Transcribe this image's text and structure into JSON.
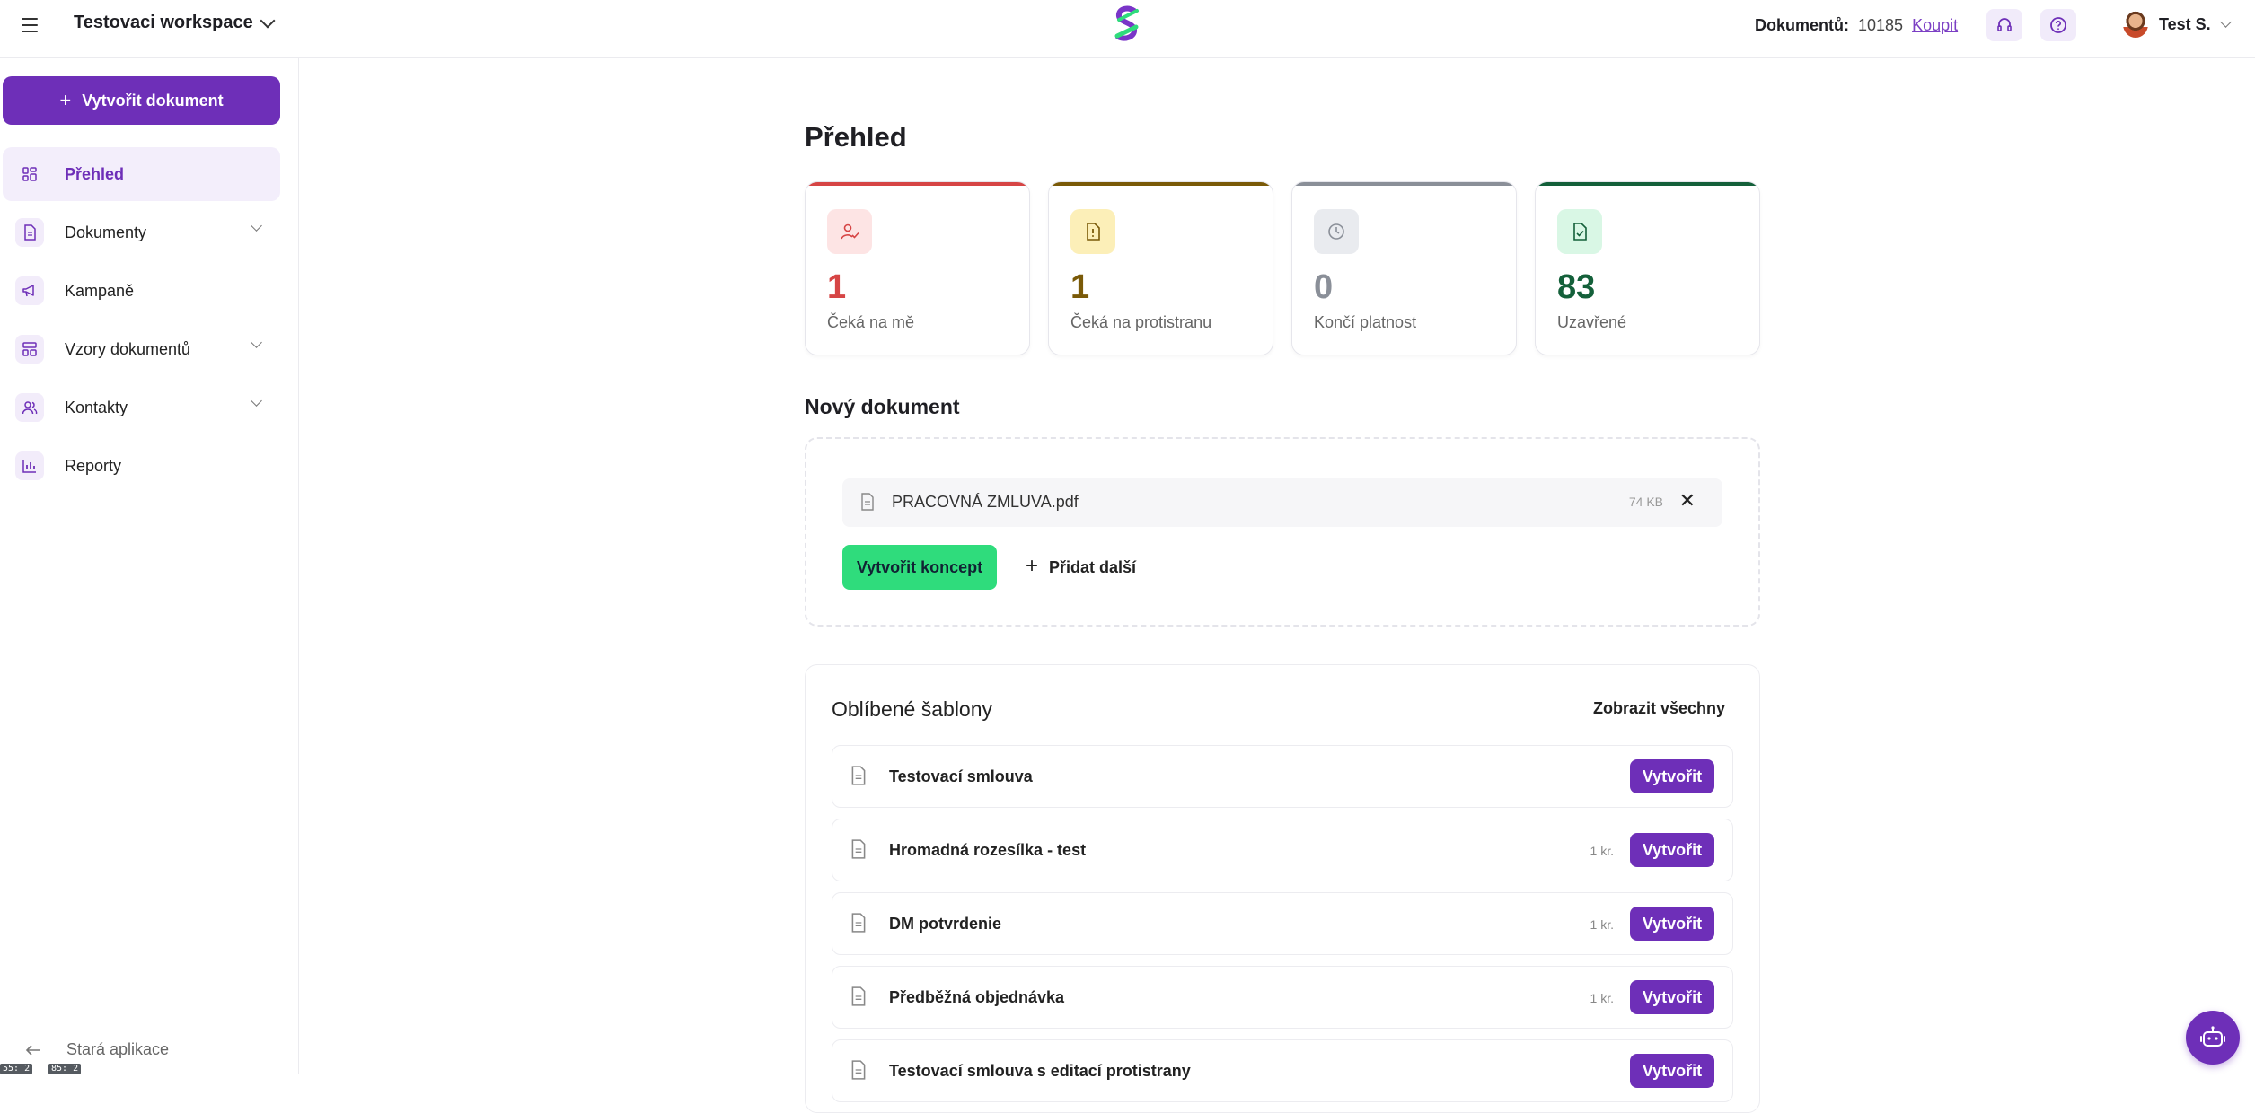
{
  "topbar": {
    "workspace": "Testovaci workspace",
    "documents_label": "Dokumentů:",
    "documents_count": "10185",
    "buy_label": "Koupit",
    "user_name": "Test S."
  },
  "sidebar": {
    "create_label": "Vytvořit dokument",
    "items": [
      {
        "label": "Přehled",
        "icon": "grid-icon",
        "active": true,
        "expandable": false
      },
      {
        "label": "Dokumenty",
        "icon": "document-icon",
        "active": false,
        "expandable": true
      },
      {
        "label": "Kampaně",
        "icon": "megaphone-icon",
        "active": false,
        "expandable": false
      },
      {
        "label": "Vzory dokumentů",
        "icon": "template-icon",
        "active": false,
        "expandable": true
      },
      {
        "label": "Kontakty",
        "icon": "users-icon",
        "active": false,
        "expandable": true
      },
      {
        "label": "Reporty",
        "icon": "bar-chart-icon",
        "active": false,
        "expandable": false
      }
    ],
    "old_app_label": "Stará aplikace",
    "tags": [
      "55: 2",
      "85: 2"
    ]
  },
  "main": {
    "title": "Přehled",
    "stats": [
      {
        "value": "1",
        "label": "Čeká na mě",
        "color": "#d64545",
        "bg": "#fde4e4",
        "icon": "user-check-icon"
      },
      {
        "value": "1",
        "label": "Čeká na protistranu",
        "color": "#7a5a08",
        "bg": "#fcefb8",
        "icon": "alert-file-icon"
      },
      {
        "value": "0",
        "label": "Končí platnost",
        "color": "#8a8f98",
        "bg": "#e9ebef",
        "icon": "clock-icon"
      },
      {
        "value": "83",
        "label": "Uzavřené",
        "color": "#14603a",
        "bg": "#d9f7e5",
        "icon": "file-check-icon"
      }
    ],
    "new_document": {
      "title": "Nový dokument",
      "file_name": "PRACOVNÁ ZMLUVA.pdf",
      "file_size": "74 KB",
      "create_concept_label": "Vytvořit koncept",
      "add_more_label": "Přidat další"
    },
    "favorites": {
      "title": "Oblíbené šablony",
      "show_all_label": "Zobrazit všechny",
      "items": [
        {
          "name": "Testovací smlouva",
          "count": "",
          "button": "Vytvořit"
        },
        {
          "name": "Hromadná rozesílka - test",
          "count": "1 kr.",
          "button": "Vytvořit"
        },
        {
          "name": "DM potvrdenie",
          "count": "1 kr.",
          "button": "Vytvořit"
        },
        {
          "name": "Předběžná objednávka",
          "count": "1 kr.",
          "button": "Vytvořit"
        },
        {
          "name": "Testovací smlouva s editací protistrany",
          "count": "",
          "button": "Vytvořit"
        }
      ]
    }
  },
  "colors": {
    "brand": "#6e2fb8",
    "accent_green": "#2fdc7c"
  }
}
